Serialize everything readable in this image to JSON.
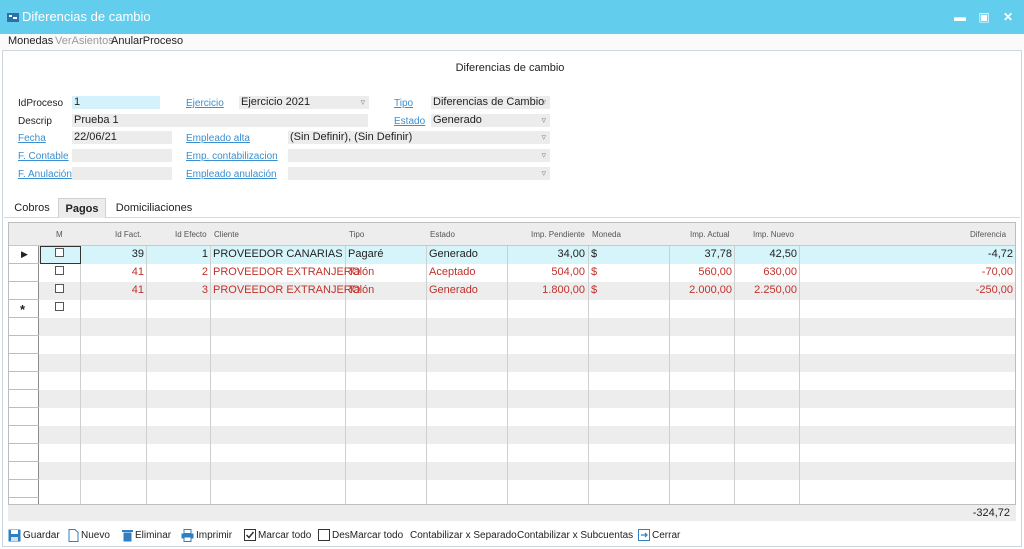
{
  "window": {
    "title": "Diferencias de cambio"
  },
  "menu": {
    "items": [
      "Monedas",
      "VerAsientos",
      "AnularProceso"
    ]
  },
  "form": {
    "heading": "Diferencias de cambio",
    "labels": {
      "idproceso": "IdProceso",
      "descrip": "Descrip",
      "fecha": "Fecha",
      "f_contable": "F. Contable",
      "f_anulacion": "F. Anulación",
      "ejercicio": "Ejercicio",
      "empleado_alta": "Empleado alta",
      "emp_contabilizacion": "Emp. contabilizacion",
      "empleado_anulacion": "Empleado anulación",
      "tipo": "Tipo",
      "estado": "Estado"
    },
    "values": {
      "idproceso": "1",
      "descrip": "Prueba 1",
      "fecha": "22/06/21",
      "f_contable": "",
      "f_anulacion": "",
      "ejercicio": "Ejercicio 2021",
      "empleado_alta": "(Sin Definir), (Sin Definir)",
      "emp_contabilizacion": "",
      "empleado_anulacion": "",
      "tipo": "Diferencias de Cambio",
      "estado": "Generado"
    }
  },
  "tabs": [
    "Cobros",
    "Pagos",
    "Domiciliaciones"
  ],
  "grid": {
    "columns": [
      "M",
      "Id Fact.",
      "Id Efecto",
      "Cliente",
      "Tipo",
      "Estado",
      "Imp. Pendiente",
      "Moneda",
      "Imp. Actual",
      "Imp. Nuevo",
      "Diferencia"
    ],
    "rows": [
      {
        "id_fact": "39",
        "id_efecto": "1",
        "cliente": "PROVEEDOR CANARIAS",
        "tipo": "Pagaré",
        "estado": "Generado",
        "imp_pendiente": "34,00",
        "moneda": "$",
        "imp_actual": "37,78",
        "imp_nuevo": "42,50",
        "diferencia": "-4,72"
      },
      {
        "id_fact": "41",
        "id_efecto": "2",
        "cliente": "PROVEEDOR EXTRANJERO",
        "tipo": "Talón",
        "estado": "Aceptado",
        "imp_pendiente": "504,00",
        "moneda": "$",
        "imp_actual": "560,00",
        "imp_nuevo": "630,00",
        "diferencia": "-70,00"
      },
      {
        "id_fact": "41",
        "id_efecto": "3",
        "cliente": "PROVEEDOR EXTRANJERO",
        "tipo": "Talón",
        "estado": "Generado",
        "imp_pendiente": "1.800,00",
        "moneda": "$",
        "imp_actual": "2.000,00",
        "imp_nuevo": "2.250,00",
        "diferencia": "-250,00"
      }
    ],
    "total_diferencia": "-324,72"
  },
  "toolbar": {
    "guardar": "Guardar",
    "nuevo": "Nuevo",
    "eliminar": "Eliminar",
    "imprimir": "Imprimir",
    "marcar_todo": "Marcar todo",
    "desmarcar_todo": "DesMarcar todo",
    "contabilizar_separado": "Contabilizar x Separado",
    "contabilizar_subcuentas": "Contabilizar x Subcuentas",
    "cerrar": "Cerrar"
  },
  "colors": {
    "titlebar": "#63cdee",
    "link": "#3a8fd0",
    "selected_row": "#d6f5fb",
    "error_red": "#c0312b"
  }
}
